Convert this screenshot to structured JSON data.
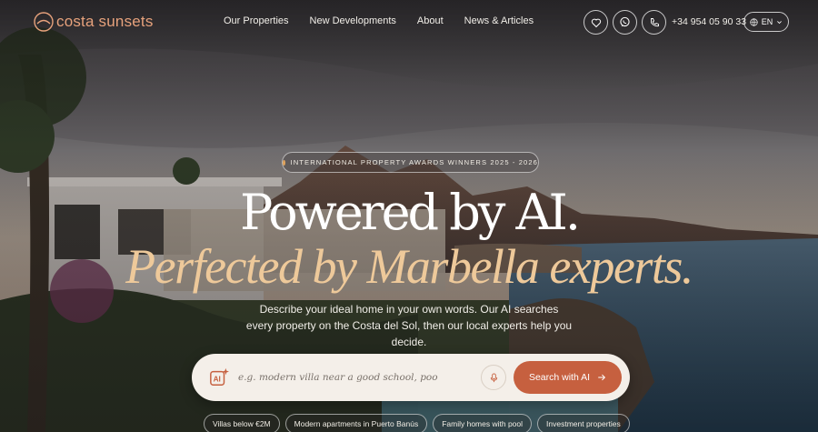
{
  "brand": {
    "name": "costa sunsets",
    "accent": "#e7a27c"
  },
  "nav": {
    "items": [
      {
        "label": "Our Properties"
      },
      {
        "label": "New Developments"
      },
      {
        "label": "About"
      },
      {
        "label": "News & Articles"
      }
    ],
    "icons": [
      "heart-icon",
      "whatsapp-icon",
      "phone-icon"
    ],
    "phone": "+34 954 05 90 33",
    "language": "EN"
  },
  "hero": {
    "badge": "INTERNATIONAL PROPERTY AWARDS WINNERS 2025 - 2026",
    "title": "Powered by AI.",
    "subtitle": "Perfected by Marbella experts.",
    "description": "Describe your ideal home in your own words. Our AI searches every property on the Costa del Sol, then our local experts help you decide."
  },
  "search": {
    "placeholder": "e.g. modern villa near a good school, poo",
    "button_label": "Search with AI",
    "button_color": "#c6603f"
  },
  "suggestions": [
    "Villas below €2M",
    "Modern apartments in Puerto Banús",
    "Family homes with pool",
    "Investment properties"
  ]
}
